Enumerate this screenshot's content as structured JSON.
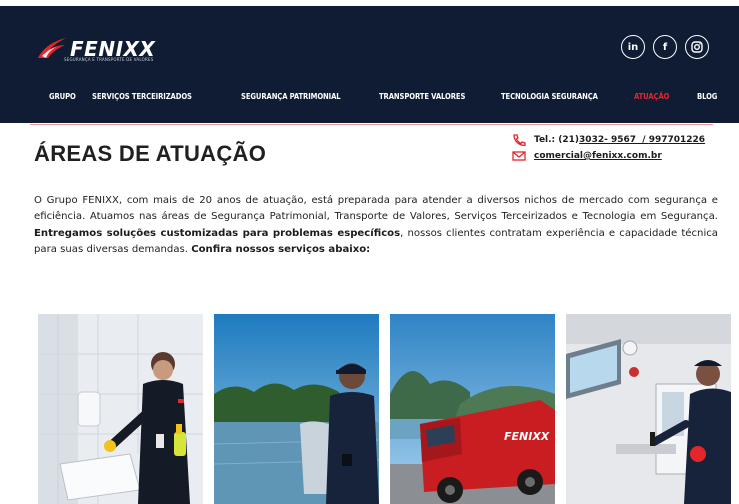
{
  "brand": {
    "name": "FENIXX",
    "tagline": "SEGURANÇA E TRANSPORTE DE VALORES"
  },
  "social": [
    {
      "label": "in",
      "icon": "linkedin-icon"
    },
    {
      "label": "f",
      "icon": "facebook-icon"
    },
    {
      "label": "",
      "icon": "instagram-icon"
    }
  ],
  "nav": [
    {
      "label": "GRUPO",
      "active": false
    },
    {
      "label": "SERVIÇOS TERCEIRIZADOS",
      "active": false
    },
    {
      "label": "SEGURANÇA PATRIMONIAL",
      "active": false
    },
    {
      "label": "TRANSPORTE VALORES",
      "active": false
    },
    {
      "label": "TECNOLOGIA SEGURANÇA",
      "active": false
    },
    {
      "label": "ATUAÇÃO",
      "active": true
    },
    {
      "label": "BLOG",
      "active": false
    }
  ],
  "page": {
    "title": "ÁREAS DE ATUAÇÃO"
  },
  "contact": {
    "phone_prefix": "Tel.: (21) ",
    "phone_1": "3032- 9567",
    "phone_sep": "  / ",
    "phone_2": "997701226",
    "email": "comercial@fenixx.com.br"
  },
  "intro": {
    "p1": "O Grupo FENIXX, com mais de 20 anos de atuação, está preparada para atender a diversos nichos de mercado com segurança e eficiência. Atuamos nas áreas de Segurança Patrimonial, Transporte de Valores, Serviços Terceirizados e Tecnologia em Segurança. ",
    "b1": "Entregamos soluções customizadas para problemas específicos",
    "p2": ", nossos clientes contratam experiência e capacidade técnica para suas diversas demandas. ",
    "b2": "Confira nossos serviços abaixo:"
  },
  "truck_label": "FENIXX",
  "colors": {
    "header_bg": "#0f1c33",
    "accent": "#e4262b"
  }
}
